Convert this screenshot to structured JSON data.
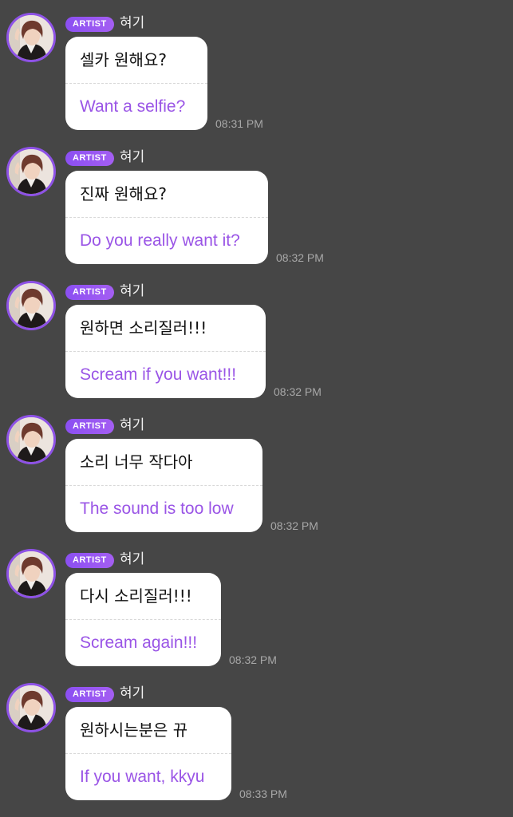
{
  "messages": [
    {
      "badge": "ARTIST",
      "name": "혀기",
      "korean": "셀카 원해요?",
      "english": "Want a selfie?",
      "time": "08:31 PM"
    },
    {
      "badge": "ARTIST",
      "name": "혀기",
      "korean": "진짜 원해요?",
      "english": "Do you really want it?",
      "time": "08:32 PM"
    },
    {
      "badge": "ARTIST",
      "name": "혀기",
      "korean": "원하면 소리질러!!!",
      "english": "Scream if you want!!!",
      "time": "08:32 PM"
    },
    {
      "badge": "ARTIST",
      "name": "혀기",
      "korean": "소리 너무 작다아",
      "english": "The sound is too low",
      "time": "08:32 PM"
    },
    {
      "badge": "ARTIST",
      "name": "혀기",
      "korean": "다시 소리질러!!!",
      "english": "Scream again!!!",
      "time": "08:32 PM"
    },
    {
      "badge": "ARTIST",
      "name": "혀기",
      "korean": "원하시는분은 뀨",
      "english": "If you want, kkyu",
      "time": "08:33 PM"
    }
  ],
  "colors": {
    "background": "#464646",
    "badge": "#8b4ff2",
    "translation_text": "#9a55e6",
    "avatar_ring": "#8e52e6"
  }
}
